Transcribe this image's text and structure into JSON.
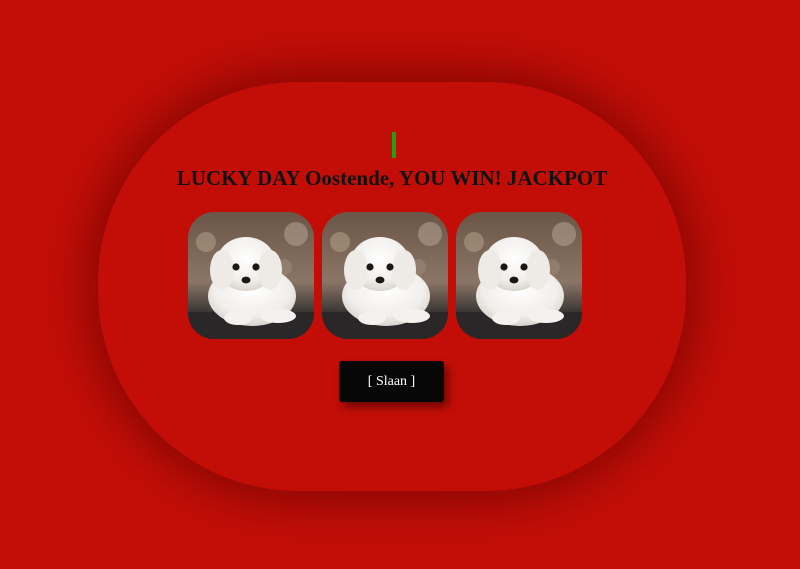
{
  "game": {
    "headline": "LUCKY DAY Oostende, YOU WIN! JACKPOT",
    "indicator_color": "#22a012",
    "background_color": "#c30e07"
  },
  "reels": [
    {
      "symbol": "white-puppy-image"
    },
    {
      "symbol": "white-puppy-image"
    },
    {
      "symbol": "white-puppy-image"
    }
  ],
  "controls": {
    "spin_label": "[ Slaan ]"
  }
}
